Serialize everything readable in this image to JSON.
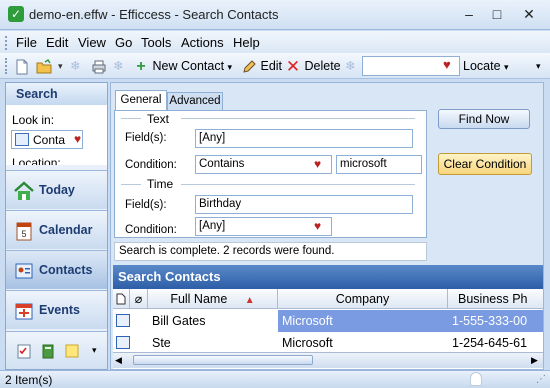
{
  "window": {
    "title": "demo-en.effw - Efficcess - Search Contacts",
    "buttons": {
      "minimize": "–",
      "maximize": "□",
      "close": "✕"
    }
  },
  "menu": [
    {
      "label": "File"
    },
    {
      "label": "Edit"
    },
    {
      "label": "View"
    },
    {
      "label": "Go"
    },
    {
      "label": "Tools"
    },
    {
      "label": "Actions"
    },
    {
      "label": "Help"
    }
  ],
  "toolbar": {
    "new_contact": "New Contact",
    "edit": "Edit",
    "delete": "Delete",
    "locate": "Locate",
    "locate_value": ""
  },
  "search_panel": {
    "title": "Search",
    "look_in_label": "Look in:",
    "look_in_value": "Conta",
    "location_label": "Location:"
  },
  "nav": [
    {
      "label": "Today",
      "icon": "home-icon"
    },
    {
      "label": "Calendar",
      "icon": "calendar-icon"
    },
    {
      "label": "Contacts",
      "icon": "contacts-icon"
    },
    {
      "label": "Events",
      "icon": "events-icon"
    }
  ],
  "tabs": {
    "general": "General",
    "advanced": "Advanced"
  },
  "form": {
    "text_section": "Text",
    "fields_label": "Field(s):",
    "fields_value": "[Any]",
    "condition_label": "Condition:",
    "condition_value": "Contains",
    "search_text": "microsoft",
    "time_section": "Time",
    "time_fields_label": "Field(s):",
    "time_fields_value": "Birthday",
    "time_condition_label": "Condition:",
    "time_condition_value": "[Any]"
  },
  "actions": {
    "find_now": "Find Now",
    "clear_condition": "Clear Condition"
  },
  "status_message": "Search is complete. 2 records were found.",
  "results": {
    "title": "Search Contacts",
    "columns": [
      "Full Name",
      "Company",
      "Business Ph"
    ],
    "rows": [
      {
        "full_name": "Bill Gates",
        "company": "Microsoft",
        "phone": "1-555-333-00"
      },
      {
        "full_name": "Ste",
        "company": "Microsoft",
        "phone": "1-254-645-61"
      }
    ]
  },
  "statusbar": {
    "count": "2 Item(s)"
  },
  "colors": {
    "selection": "#7a9be2",
    "accent": "#2d5ea6",
    "heart": "#bb2222"
  }
}
